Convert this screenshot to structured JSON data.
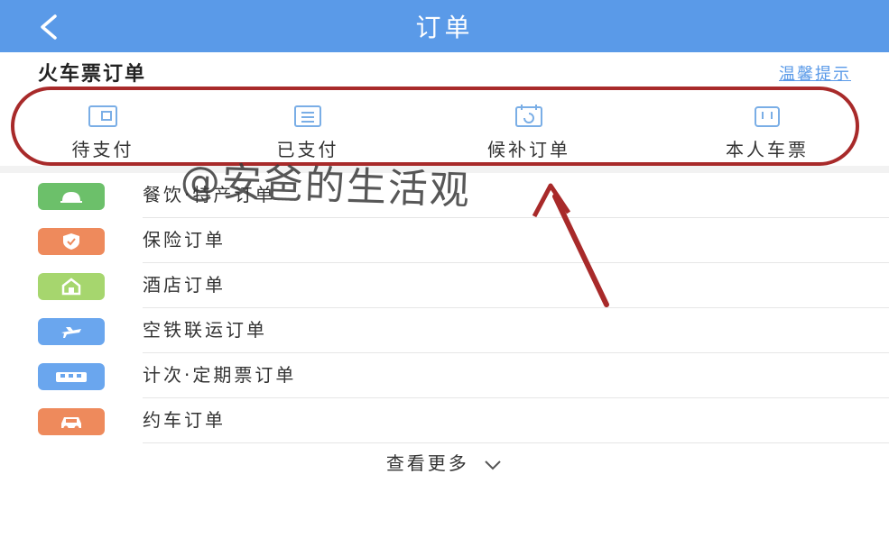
{
  "header": {
    "title": "订单",
    "back_icon": "chevron-left-icon",
    "bg_color": "#5a9ae8"
  },
  "section": {
    "title": "火车票订单",
    "tip_label": "温馨提示"
  },
  "status_tabs": [
    {
      "label": "待支付",
      "icon": "wallet-icon"
    },
    {
      "label": "已支付",
      "icon": "clipboard-icon"
    },
    {
      "label": "候补订单",
      "icon": "calendar-refresh-icon"
    },
    {
      "label": "本人车票",
      "icon": "ticket-icon"
    }
  ],
  "orders": [
    {
      "label": "餐饮·特产订单",
      "icon": "food-cloche-icon",
      "color": "#6cc06a"
    },
    {
      "label": "保险订单",
      "icon": "shield-icon",
      "color": "#ee8a5c"
    },
    {
      "label": "酒店订单",
      "icon": "hotel-icon",
      "color": "#a6d66e"
    },
    {
      "label": "空铁联运订单",
      "icon": "plane-icon",
      "color": "#6aa6ee"
    },
    {
      "label": "计次·定期票订单",
      "icon": "train-ticket-icon",
      "color": "#6aa6ee"
    },
    {
      "label": "约车订单",
      "icon": "car-icon",
      "color": "#ee8a5c"
    }
  ],
  "more_label": "查看更多",
  "watermark": "@安爸的生活观",
  "annotation_color": "#a82a2a"
}
